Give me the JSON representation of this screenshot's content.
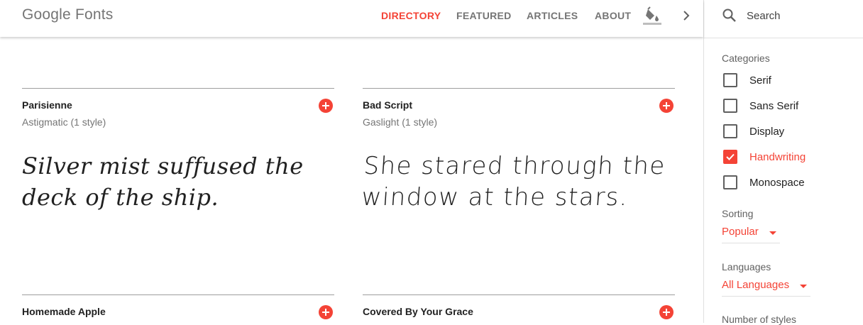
{
  "header": {
    "logo": "Google Fonts",
    "nav": [
      {
        "label": "DIRECTORY",
        "active": true
      },
      {
        "label": "FEATURED",
        "active": false
      },
      {
        "label": "ARTICLES",
        "active": false
      },
      {
        "label": "ABOUT",
        "active": false
      }
    ],
    "icons": {
      "paint": "format-color-fill-icon",
      "next": "chevron-right-icon"
    }
  },
  "sidebar": {
    "search": {
      "placeholder": "Search",
      "value": ""
    },
    "categories": {
      "label": "Categories",
      "items": [
        {
          "label": "Serif",
          "checked": false
        },
        {
          "label": "Sans Serif",
          "checked": false
        },
        {
          "label": "Display",
          "checked": false
        },
        {
          "label": "Handwriting",
          "checked": true
        },
        {
          "label": "Monospace",
          "checked": false
        }
      ]
    },
    "sorting": {
      "label": "Sorting",
      "value": "Popular"
    },
    "languages": {
      "label": "Languages",
      "value": "All Languages"
    },
    "styles": {
      "label": "Number of styles"
    }
  },
  "cards": [
    {
      "name": "Parisienne",
      "sub": "Astigmatic (1 style)",
      "sample": "Silver mist suffused the deck of the ship."
    },
    {
      "name": "Bad Script",
      "sub": "Gaslight (1 style)",
      "sample": "She stared through the window at the stars."
    },
    {
      "name": "Homemade Apple"
    },
    {
      "name": "Covered By Your Grace"
    }
  ],
  "colors": {
    "accent": "#f44336",
    "text": "#212121",
    "muted": "#757575",
    "divider": "#e0e0e0"
  }
}
